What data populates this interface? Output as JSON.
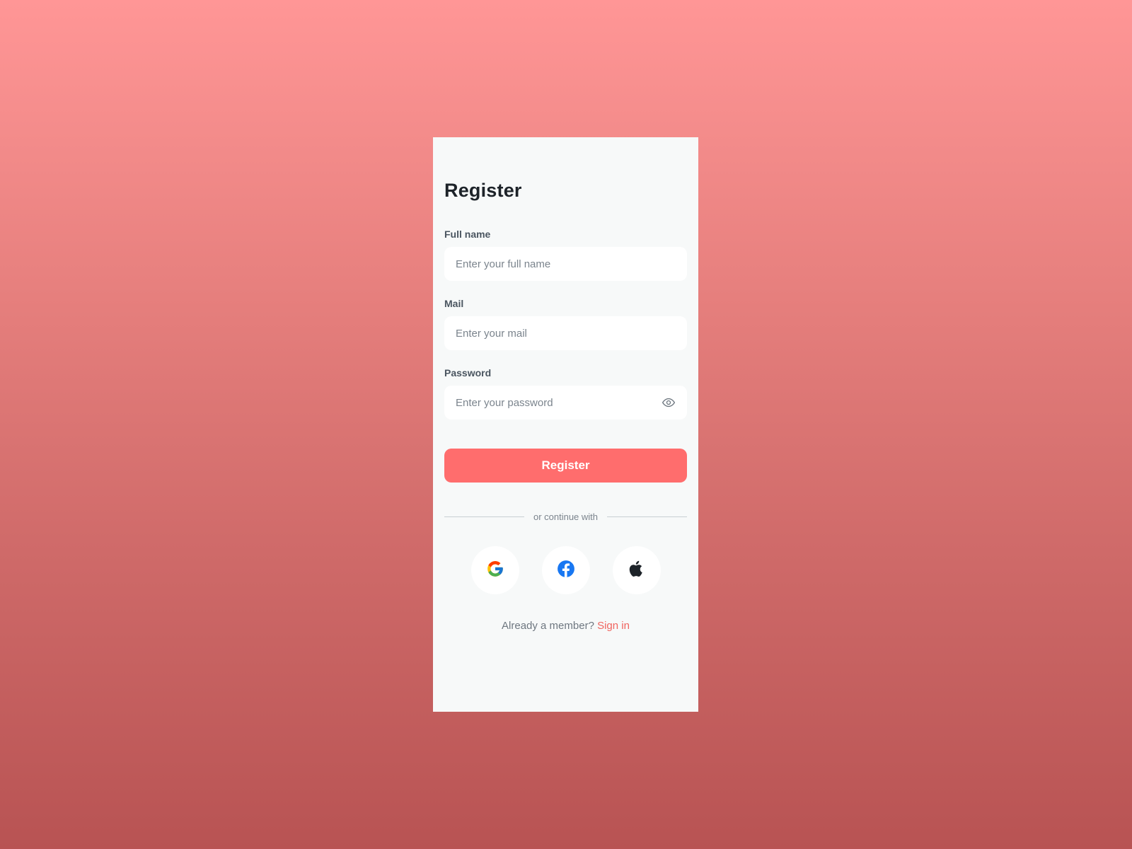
{
  "form": {
    "title": "Register",
    "full_name": {
      "label": "Full name",
      "placeholder": "Enter your full name"
    },
    "mail": {
      "label": "Mail",
      "placeholder": "Enter your mail"
    },
    "password": {
      "label": "Password",
      "placeholder": "Enter your password"
    },
    "submit_label": "Register",
    "divider_text": "or continue with",
    "socials": [
      {
        "name": "google",
        "icon": "google-icon"
      },
      {
        "name": "facebook",
        "icon": "facebook-icon"
      },
      {
        "name": "apple",
        "icon": "apple-icon"
      }
    ],
    "footer_text": "Already a member?",
    "footer_link": "Sign in"
  },
  "colors": {
    "accent": "#ff6d6d",
    "link": "#f0645f",
    "card_background": "#f7f9f9",
    "background_top": "#ff9696",
    "background_bottom": "#b85353",
    "heading": "#1d2329"
  }
}
